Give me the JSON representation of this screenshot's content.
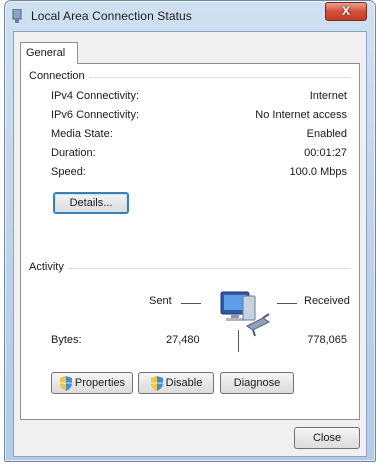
{
  "window": {
    "title": "Local Area Connection Status",
    "close_label": "X"
  },
  "tab": {
    "label": "General"
  },
  "connection": {
    "heading": "Connection",
    "rows": [
      {
        "label": "IPv4 Connectivity:",
        "value": "Internet"
      },
      {
        "label": "IPv6 Connectivity:",
        "value": "No Internet access"
      },
      {
        "label": "Media State:",
        "value": "Enabled"
      },
      {
        "label": "Duration:",
        "value": "00:01:27"
      },
      {
        "label": "Speed:",
        "value": "100.0 Mbps"
      }
    ],
    "details_label": "Details..."
  },
  "activity": {
    "heading": "Activity",
    "sent_label": "Sent",
    "received_label": "Received",
    "bytes_label": "Bytes:",
    "bytes_sent": "27,480",
    "bytes_received": "778,065"
  },
  "buttons": {
    "properties": "Properties",
    "disable": "Disable",
    "diagnose": "Diagnose",
    "close": "Close"
  },
  "icons": {
    "title": "network-connection-icon",
    "activity": "network-computers-icon",
    "shield": "uac-shield-icon"
  }
}
